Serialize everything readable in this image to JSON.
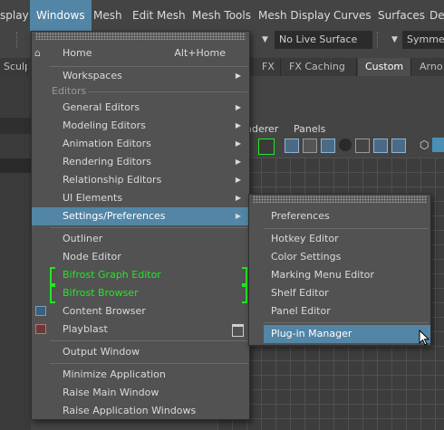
{
  "menubar": {
    "items": [
      {
        "label": "splay"
      },
      {
        "label": "Windows"
      },
      {
        "label": "Mesh"
      },
      {
        "label": "Edit Mesh"
      },
      {
        "label": "Mesh Tools"
      },
      {
        "label": "Mesh Display"
      },
      {
        "label": "Curves"
      },
      {
        "label": "Surfaces"
      },
      {
        "label": "Def"
      }
    ]
  },
  "toolbar": {
    "surface_dropdown": "No Live Surface",
    "symmetry_dropdown": "Symmet"
  },
  "shelf": {
    "tabs": [
      "Sculptin",
      "FX",
      "FX Caching",
      "Custom",
      "Arno"
    ],
    "active": "Custom"
  },
  "viewport": {
    "menu_items": [
      "nderer",
      "Panels"
    ]
  },
  "windows_menu": {
    "home": {
      "label": "Home",
      "shortcut": "Alt+Home"
    },
    "workspaces": "Workspaces",
    "editors_section": "Editors",
    "items": {
      "general_editors": "General Editors",
      "modeling_editors": "Modeling Editors",
      "animation_editors": "Animation Editors",
      "rendering_editors": "Rendering Editors",
      "relationship_editors": "Relationship Editors",
      "ui_elements": "UI Elements",
      "settings_preferences": "Settings/Preferences",
      "outliner": "Outliner",
      "node_editor": "Node Editor",
      "bifrost_graph_editor": "Bifrost Graph Editor",
      "bifrost_browser": "Bifrost Browser",
      "content_browser": "Content Browser",
      "playblast": "Playblast",
      "output_window": "Output Window",
      "minimize_application": "Minimize Application",
      "raise_main_window": "Raise Main Window",
      "raise_application_windows": "Raise Application Windows"
    }
  },
  "settings_submenu": {
    "items": [
      "Preferences",
      "Hotkey Editor",
      "Color Settings",
      "Marking Menu Editor",
      "Shelf Editor",
      "Panel Editor",
      "Plug-in Manager"
    ],
    "selected": "Plug-in Manager"
  },
  "colors": {
    "highlight": "#5285a6",
    "bifrost_green": "#22e822",
    "menu_bg": "#525252"
  }
}
